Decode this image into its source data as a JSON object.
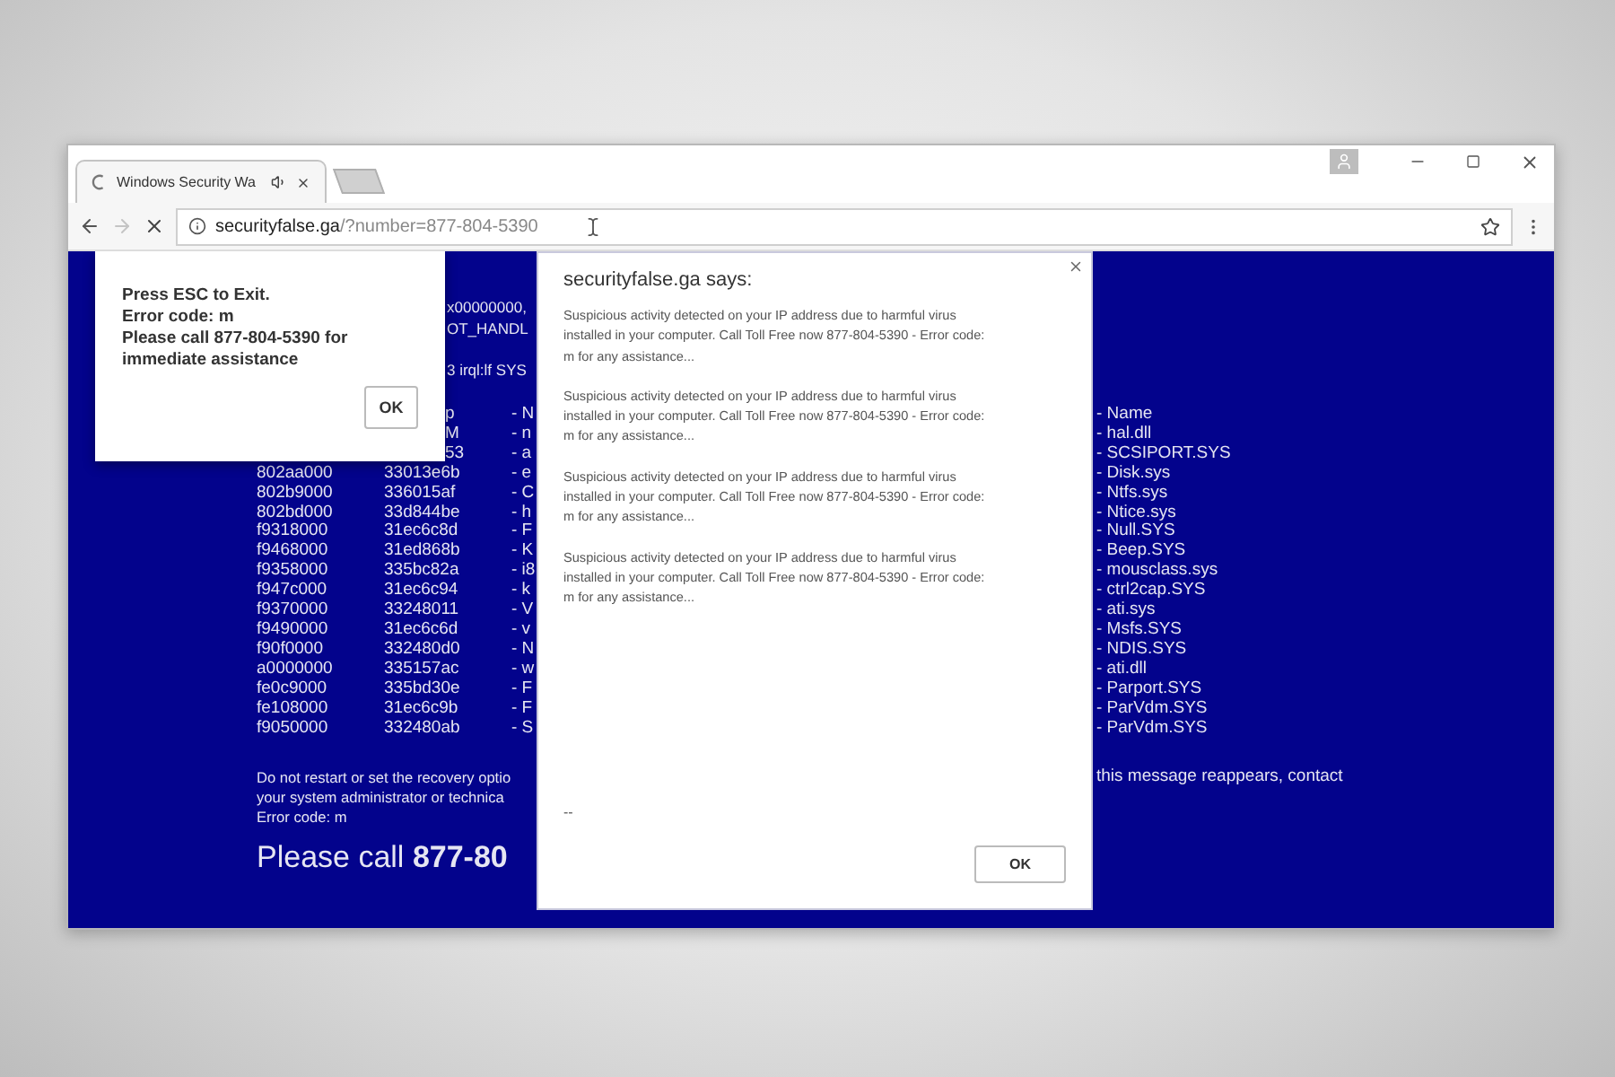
{
  "browser": {
    "tabs": [
      {
        "title": "Windows Security Wa",
        "selected": true,
        "loading": true
      }
    ],
    "nav": {
      "forward_disabled": true
    },
    "address": {
      "domain": "securityfalse.ga",
      "path": "/?number=877-804-5390"
    }
  },
  "bsod": {
    "header_lines": [
      "x00000000,",
      "OT_HANDL",
      "3 irql:lf SYS"
    ],
    "rows": [
      {
        "covered_start": true,
        "value": "p",
        "module": "- N",
        "name": "- Name"
      },
      {
        "covered_start": true,
        "value": "M",
        "module": "- n",
        "name": "- hal.dll"
      },
      {
        "covered_start": true,
        "value": "53",
        "module": "- a",
        "name": "- SCSIPORT.SYS"
      },
      {
        "covered_start": false,
        "address": "802aa000",
        "value": "33013e6b",
        "module": "- e",
        "name": "- Disk.sys"
      },
      {
        "covered_start": false,
        "address": "802b9000",
        "value": "336015af",
        "module": "- C",
        "name": "- Ntfs.sys"
      },
      {
        "covered_start": false,
        "address": "802bd000",
        "value": "33d844be",
        "module": "- h",
        "name": "- Ntice.sys"
      },
      {
        "covered_start": false,
        "address": "f9318000",
        "value": "31ec6c8d",
        "module": "- F",
        "name": "- Null.SYS"
      },
      {
        "covered_start": false,
        "address": "f9468000",
        "value": "31ed868b",
        "module": "- K",
        "name": "- Beep.SYS"
      },
      {
        "covered_start": false,
        "address": "f9358000",
        "value": "335bc82a",
        "module": "- i8",
        "name": "- mousclass.sys"
      },
      {
        "covered_start": false,
        "address": "f947c000",
        "value": "31ec6c94",
        "module": "- k",
        "name": "- ctrl2cap.SYS"
      },
      {
        "covered_start": false,
        "address": "f9370000",
        "value": "33248011",
        "module": "- V",
        "name": "- ati.sys"
      },
      {
        "covered_start": false,
        "address": "f9490000",
        "value": "31ec6c6d",
        "module": "- v",
        "name": "- Msfs.SYS"
      },
      {
        "covered_start": false,
        "address": "f90f0000",
        "value": "332480d0",
        "module": "- N",
        "name": "- NDIS.SYS"
      },
      {
        "covered_start": false,
        "address": "a0000000",
        "value": "335157ac",
        "module": "- w",
        "name": "- ati.dll"
      },
      {
        "covered_start": false,
        "address": "fe0c9000",
        "value": "335bd30e",
        "module": "- F",
        "name": "- Parport.SYS"
      },
      {
        "covered_start": false,
        "address": "fe108000",
        "value": "31ec6c9b",
        "module": "- F",
        "name": "- ParVdm.SYS"
      },
      {
        "covered_start": false,
        "address": "f9050000",
        "value": "332480ab",
        "module": "- S",
        "name": "- ParVdm.SYS"
      }
    ],
    "footer": {
      "left_lines": [
        "Do not restart or set the recovery optio",
        "your system administrator or technica",
        "Error code: m"
      ],
      "right_line": "this message reappears, contact",
      "call": "Please call **877-80**"
    }
  },
  "alert_popup": {
    "lines": [
      "Press ESC to Exit.",
      "Error code: m",
      "Please call 877-804-5390 for immediate assistance"
    ],
    "button": "OK"
  },
  "dialog": {
    "title": "securityfalse.ga says:",
    "messages": [
      "Suspicious activity detected on your IP address due to harmful virus installed in your computer. Call Toll Free now  877-804-5390 - Error code: m for any assistance...",
      "Suspicious activity detected on your IP address due to harmful virus installed in your computer. Call Toll Free now  877-804-5390 - Error code: m for any assistance...",
      "Suspicious activity detected on your IP address due to harmful virus installed in your computer. Call Toll Free now  877-804-5390 - Error code: m for any assistance...",
      "Suspicious activity detected on your IP address due to harmful virus installed in your computer. Call Toll Free now  877-804-5390 - Error code: m for any assistance..."
    ],
    "trailer": "--",
    "button": "OK"
  }
}
